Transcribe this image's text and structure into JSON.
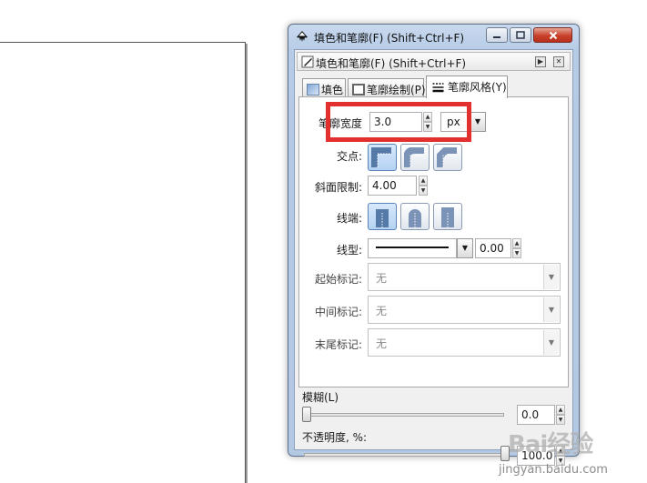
{
  "window": {
    "title": "填色和笔廓(F) (Shift+Ctrl+F)"
  },
  "dock": {
    "title": "填色和笔廓(F) (Shift+Ctrl+F)"
  },
  "tabs": [
    {
      "label": "填色"
    },
    {
      "label": "笔廓绘制(P)"
    },
    {
      "label": "笔廓风格(Y)"
    }
  ],
  "stroke_style": {
    "width_label": "笔廓宽度",
    "width_value": "3.0",
    "unit": "px",
    "join_label": "交点:",
    "miter_label": "斜面限制:",
    "miter_value": "4.00",
    "cap_label": "线端:",
    "dash_label": "线型:",
    "dash_offset": "0.00",
    "start_marker_label": "起始标记:",
    "start_marker_value": "无",
    "mid_marker_label": "中间标记:",
    "mid_marker_value": "无",
    "end_marker_label": "末尾标记:",
    "end_marker_value": "无"
  },
  "blur": {
    "label": "模糊(L)",
    "value": "0.0"
  },
  "opacity": {
    "label": "不透明度, %:",
    "value": "100.0"
  },
  "watermark": {
    "main": "Bai经验",
    "sub": "jingyan.baidu.com"
  },
  "colors": {
    "highlight": "#e2302f",
    "titlebar": "#b9cde7",
    "close_button": "#c8412b"
  }
}
